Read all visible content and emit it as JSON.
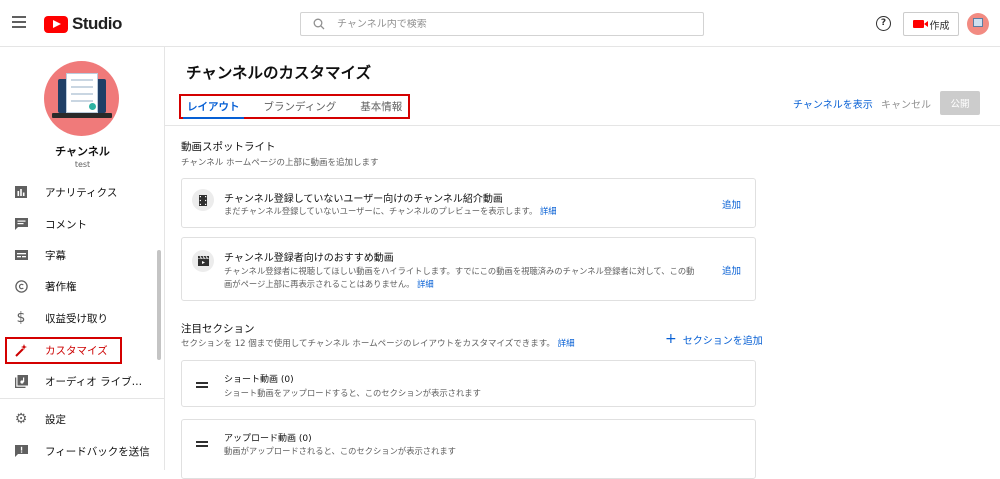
{
  "topbar": {
    "logo_text": "Studio",
    "search_placeholder": "チャンネル内で検索",
    "help_symbol": "?",
    "create_label": "作成"
  },
  "sidebar": {
    "channel_name": "チャンネル",
    "channel_handle": "test",
    "items": [
      {
        "label": "アナリティクス",
        "icon": "analytics-icon"
      },
      {
        "label": "コメント",
        "icon": "comment-icon"
      },
      {
        "label": "字幕",
        "icon": "subtitles-icon"
      },
      {
        "label": "著作権",
        "icon": "copyright-icon"
      },
      {
        "label": "収益受け取り",
        "icon": "dollar-icon"
      },
      {
        "label": "カスタマイズ",
        "icon": "magic-wand-icon",
        "active": true
      },
      {
        "label": "オーディオ ライブ…",
        "icon": "audio-library-icon"
      },
      {
        "label": "設定",
        "icon": "gear-icon"
      },
      {
        "label": "フィードバックを送信",
        "icon": "feedback-icon"
      }
    ]
  },
  "main": {
    "title": "チャンネルのカスタマイズ",
    "tabs": [
      {
        "label": "レイアウト",
        "active": true
      },
      {
        "label": "ブランディング"
      },
      {
        "label": "基本情報"
      }
    ],
    "view_channel": "チャンネルを表示",
    "cancel": "キャンセル",
    "publish": "公開",
    "spotlight": {
      "title": "動画スポットライト",
      "subtitle": "チャンネル ホームページの上部に動画を追加します",
      "cards": [
        {
          "title": "チャンネル登録していないユーザー向けのチャンネル紹介動画",
          "desc": "まだチャンネル登録していないユーザーに、チャンネルのプレビューを表示します。",
          "link": "詳細",
          "add": "追加"
        },
        {
          "title": "チャンネル登録者向けのおすすめ動画",
          "desc1": "チャンネル登録者に視聴してほしい動画をハイライトします。すでにこの動画を視聴済みのチャンネル登録者に対して、この動",
          "desc2": "画がページ上部に再表示されることはありません。",
          "link": "詳細",
          "add": "追加"
        }
      ]
    },
    "featured": {
      "title": "注目セクション",
      "subtitle": "セクションを 12 個まで使用してチャンネル ホームページのレイアウトをカスタマイズできます。",
      "link": "詳細",
      "add_section": "セクションを追加",
      "sections": [
        {
          "title": "ショート動画 (0)",
          "desc": "ショート動画をアップロードすると、このセクションが表示されます"
        },
        {
          "title": "アップロード動画 (0)",
          "desc": "動画がアップロードされると、このセクションが表示されます"
        }
      ]
    }
  }
}
